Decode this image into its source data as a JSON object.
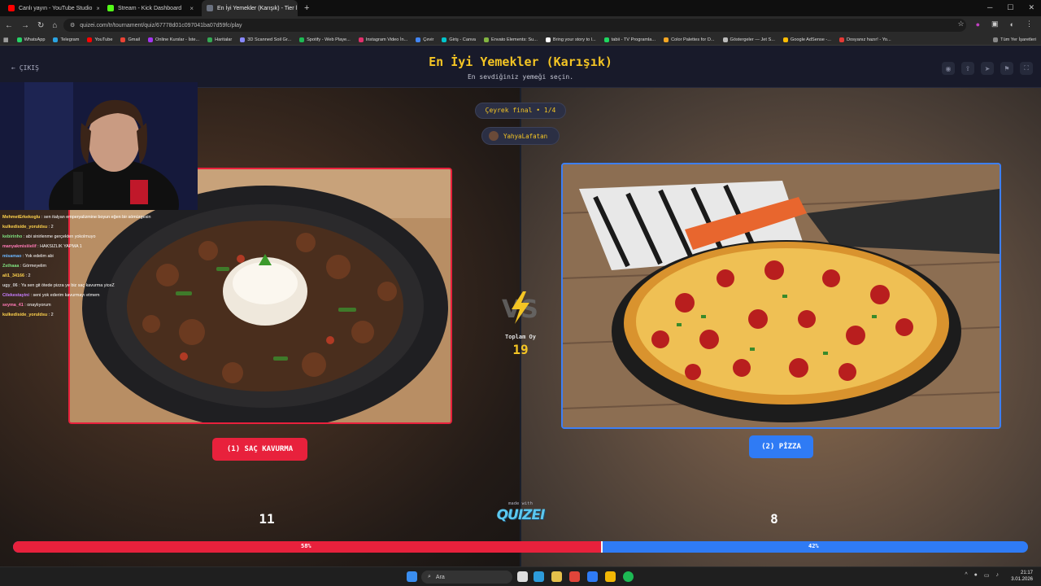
{
  "browser": {
    "tabs": [
      {
        "label": "Canlı yayın - YouTube Studio",
        "color": "#ff0000"
      },
      {
        "label": "Stream - Kick Dashboard",
        "color": "#53fc18"
      },
      {
        "label": "En İyi Yemekler (Karışık) - Tier l",
        "color": "#6b7280"
      }
    ],
    "new_tab": "+",
    "url": "quizei.com/tr/tournament/quiz/67778d01c097041ba07d59fc/play",
    "bookmarks": [
      {
        "label": "WhatsApp",
        "color": "#25d366"
      },
      {
        "label": "Telegram",
        "color": "#2aa3e2"
      },
      {
        "label": "YouTube",
        "color": "#ff0000"
      },
      {
        "label": "Gmail",
        "color": "#ea4335"
      },
      {
        "label": "Online Kurslar - İste...",
        "color": "#a435f0"
      },
      {
        "label": "Haritalar",
        "color": "#34a853"
      },
      {
        "label": "3D Scanned Soil Gr...",
        "color": "#8888ff"
      },
      {
        "label": "Spotify - Web Playe...",
        "color": "#1db954"
      },
      {
        "label": "Instagram Video İn...",
        "color": "#e1306c"
      },
      {
        "label": "Çevir",
        "color": "#4285f4"
      },
      {
        "label": "Giriş - Canva",
        "color": "#00c4cc"
      },
      {
        "label": "Envato Elements: Su...",
        "color": "#82b541"
      },
      {
        "label": "Bring your story to l...",
        "color": "#ffffff"
      },
      {
        "label": "tabii - TV Programla...",
        "color": "#1ed760"
      },
      {
        "label": "Color Palettes for D...",
        "color": "#f5a623"
      },
      {
        "label": "Göstergeler — Jet S...",
        "color": "#bbbbbb"
      },
      {
        "label": "Google AdSense -...",
        "color": "#fbbc04"
      },
      {
        "label": "Dosyanız hazır! - Yo...",
        "color": "#e53935"
      }
    ],
    "all_bookmarks": "Tüm Yer İşaretleri"
  },
  "header": {
    "back_label": "ÇIKIŞ",
    "title": "En İyi Yemekler (Karışık)",
    "subtitle": "En sevdiğiniz yemeği seçin."
  },
  "match": {
    "round": "Çeyrek final • 1/4",
    "author": "YahyaLafatan",
    "total_label": "Toplam Oy",
    "total_votes": "19",
    "made_with": "made with",
    "brand": "QUIZEI",
    "left": {
      "label": "(1) SAÇ KAVURMA",
      "votes": "11",
      "percent": "58%",
      "share": 0.58,
      "color": "#e8213c"
    },
    "right": {
      "label": "(2) PİZZA",
      "votes": "8",
      "percent": "42%",
      "share": 0.42,
      "color": "#2f7bf5"
    }
  },
  "chat": [
    {
      "user": "MehmetErkekoglu",
      "color": "#ffd34d",
      "msg": "sen italyan emperyalizmine boyun eğen bir sömürgesin"
    },
    {
      "user": "kulkedisíde_yoruldsu",
      "color": "#ffd34d",
      "msg": "2"
    },
    {
      "user": "kebirinho",
      "color": "#7fe07f",
      "msg": "abi sinirlenme gerçekten yokolmuyo"
    },
    {
      "user": "manyakmisiiielif",
      "color": "#ff7ab6",
      "msg": "HAKSIZLIK YAPMA 1"
    },
    {
      "user": "misamao",
      "color": "#6bb7ff",
      "msg": "Yok edelim abi"
    },
    {
      "user": "Zsthaaa",
      "color": "#7fe07f",
      "msg": "Görmeyelim"
    },
    {
      "user": "ali1_34166",
      "color": "#ffd34d",
      "msg": "2"
    },
    {
      "user": "ugy_06",
      "color": "#cfcfcf",
      "msg": "Ya sen git ötede pizza ye biz saç kavurma yiceZ"
    },
    {
      "user": "Cilekestayini",
      "color": "#c77dff",
      "msg": "seni yok ederim kavurmayı etmem"
    },
    {
      "user": "seyma_41",
      "color": "#ff7ab6",
      "msg": "onaylıyorum"
    },
    {
      "user": "kulkedisíde_yoruldsu",
      "color": "#ffd34d",
      "msg": "2"
    }
  ],
  "taskbar": {
    "search_placeholder": "Ara",
    "time": "21:17",
    "date": "3.01.2026"
  }
}
